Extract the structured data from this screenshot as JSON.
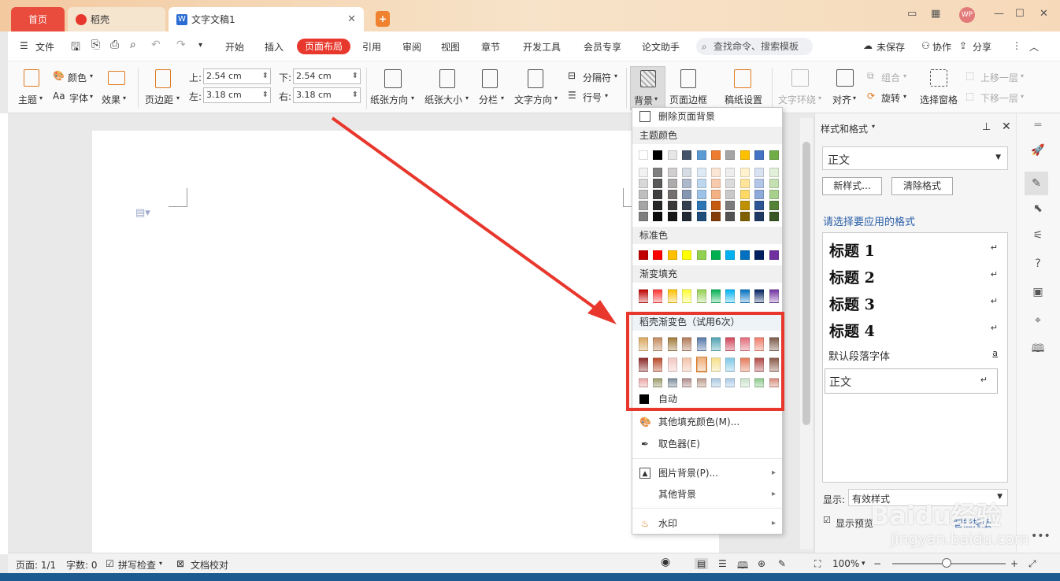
{
  "tabs": {
    "home": "首页",
    "daoke": "稻壳",
    "doc": "文字文稿1"
  },
  "menu": {
    "file": "文件",
    "items": [
      "开始",
      "插入",
      "页面布局",
      "引用",
      "审阅",
      "视图",
      "章节",
      "开发工具",
      "会员专享",
      "论文助手"
    ],
    "search_placeholder": "查找命令、搜索模板",
    "unsaved": "未保存",
    "collab": "协作",
    "share": "分享"
  },
  "ribbon": {
    "theme": "主题",
    "color": "颜色",
    "font": "字体",
    "effect": "效果",
    "margins": "页边距",
    "top_label": "上:",
    "top_value": "2.54 cm",
    "bottom_label": "下:",
    "bottom_value": "2.54 cm",
    "left_label": "左:",
    "left_value": "3.18 cm",
    "right_label": "右:",
    "right_value": "3.18 cm",
    "orientation": "纸张方向",
    "size": "纸张大小",
    "columns": "分栏",
    "text_dir": "文字方向",
    "separator": "分隔符",
    "line_no": "行号",
    "background": "背景",
    "page_border": "页面边框",
    "paper_setup": "稿纸设置",
    "wrap": "文字环绕",
    "align": "对齐",
    "rotate": "旋转",
    "select_pane": "选择窗格",
    "group": "组合",
    "bring_forward": "上移一层",
    "send_backward": "下移一层"
  },
  "dropdown": {
    "delete_bg": "删除页面背景",
    "theme_colors": "主题颜色",
    "standard_colors": "标准色",
    "gradient_fill": "渐变填充",
    "daoke_gradient": "稻壳渐变色（试用6次）",
    "auto": "自动",
    "more_fill": "其他填充颜色(M)...",
    "picker": "取色器(E)",
    "picture_bg": "图片背景(P)...",
    "other_bg": "其他背景",
    "watermark": "水印",
    "theme_row": [
      "#ffffff",
      "#000000",
      "#e7e6e6",
      "#44546a",
      "#5b9bd5",
      "#ed7d31",
      "#a5a5a5",
      "#ffc000",
      "#4472c4",
      "#70ad47"
    ],
    "theme_shades": [
      [
        "#f2f2f2",
        "#7f7f7f",
        "#d0cece",
        "#d6dce4",
        "#deebf6",
        "#fbe5d5",
        "#ededed",
        "#fff2cc",
        "#d9e2f3",
        "#e2efd9"
      ],
      [
        "#d8d8d8",
        "#595959",
        "#aeabab",
        "#adb9ca",
        "#bdd7ee",
        "#f7cbac",
        "#dbdbdb",
        "#fee599",
        "#b4c6e7",
        "#c5e0b3"
      ],
      [
        "#bfbfbf",
        "#3f3f3f",
        "#757070",
        "#8496b0",
        "#9dc3e6",
        "#f4b183",
        "#c9c9c9",
        "#ffd965",
        "#8eaadb",
        "#a8d08d"
      ],
      [
        "#a5a5a5",
        "#262626",
        "#3a3838",
        "#323f4f",
        "#2e75b5",
        "#c55a11",
        "#7b7b7b",
        "#bf9000",
        "#2f5496",
        "#538135"
      ],
      [
        "#7f7f7f",
        "#0c0c0c",
        "#171616",
        "#222a35",
        "#1e4e79",
        "#843c0b",
        "#525252",
        "#7f6000",
        "#1f3864",
        "#375623"
      ]
    ],
    "standard_row": [
      "#c00000",
      "#ff0000",
      "#ffc000",
      "#ffff00",
      "#92d050",
      "#00b050",
      "#00b0f0",
      "#0070c0",
      "#002060",
      "#7030a0"
    ],
    "gradient_row": [
      "#c00000",
      "#ff3333",
      "#ffc000",
      "#ffff33",
      "#92d050",
      "#00b050",
      "#00b0f0",
      "#0070c0",
      "#002060",
      "#7030a0"
    ],
    "daoke_rows": [
      [
        "#d9a85f",
        "#c38a5e",
        "#a07a3a",
        "#b07a58",
        "#5577a8",
        "#4fa3b3",
        "#d0465a",
        "#e26b7a",
        "#ef7d6a",
        "#7a5a4a"
      ],
      [
        "#8c2a2a",
        "#b94a2a",
        "#f1c7c3",
        "#f3c2a8",
        "#f1b07a",
        "#f6e08a",
        "#7fc9e6",
        "#e47a5a",
        "#b34a4a",
        "#8a5a48"
      ],
      [
        "#e9a4a4",
        "#9a9a6a",
        "#7a8a9a",
        "#b08a8a",
        "#b99a8a",
        "#a8c8e0",
        "#a9c9e6",
        "#c8e0c8",
        "#8ac88a",
        "#d88a7a"
      ]
    ]
  },
  "panel": {
    "title": "样式和格式",
    "current": "正文",
    "new_style": "新样式...",
    "clear_format": "清除格式",
    "choose_label": "请选择要应用的格式",
    "styles": [
      "标题 1",
      "标题 2",
      "标题 3",
      "标题 4"
    ],
    "default_font": "默认段落字体",
    "body": "正文",
    "show_label": "显示:",
    "show_value": "有效样式",
    "preview": "显示预览",
    "smart": "智能排版"
  },
  "status": {
    "page": "页面: 1/1",
    "words": "字数: 0",
    "spell": "拼写检查",
    "proof": "文档校对",
    "zoom": "100%"
  },
  "watermark": {
    "brand": "Baidu经验",
    "url": "jingyan.baidu.com"
  }
}
